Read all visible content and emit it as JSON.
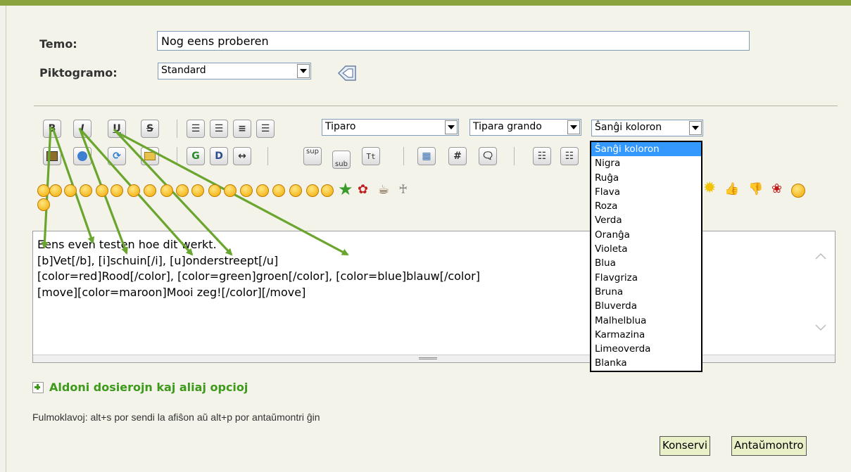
{
  "subject": {
    "label": "Temo:",
    "value": "Nog eens proberen"
  },
  "icon": {
    "label": "Piktogramo:",
    "value": "Standard"
  },
  "toolbar": {
    "row1": [
      "B",
      "I",
      "U",
      "S"
    ],
    "font_face": "Tiparo",
    "font_size": "Tipara grando",
    "font_color": "Ŝanĝi koloron",
    "row2_labels": {
      "g": "G",
      "sup": "sup",
      "sub": "sub",
      "tt": "Tt",
      "hash": "#"
    }
  },
  "color_options": [
    "Ŝanĝi koloron",
    "Nigra",
    "Ruĝa",
    "Flava",
    "Roza",
    "Verda",
    "Oranĝa",
    "Violeta",
    "Blua",
    "Flavgriza",
    "Bruna",
    "Bluverda",
    "Malhelblua",
    "Karmazina",
    "Limeoverda",
    "Blanka"
  ],
  "editor": {
    "lines": [
      "Eens even testen hoe dit werkt.",
      "[b]Vet[/b], [i]schuin[/i], [u]onderstreept[/u]",
      "[color=red]Rood[/color], [color=green]groen[/color], [color=blue]blauw[/color]",
      "[move][color=maroon]Mooi zeg![/color][/move]"
    ]
  },
  "more_options": "Aldoni dosierojn kaj aliaj opcioj",
  "shortcuts": "Fulmoklavoj: alt+s por sendi la afiŝon aŭ alt+p por antaŭmontri ĝin",
  "buttons": {
    "save": "Konservi",
    "preview": "Antaŭmontro"
  },
  "colors": {
    "accent_green": "#3d9a1a",
    "arrow_green": "#6aa52e",
    "selected_blue": "#3399ff",
    "button_bg": "#e9f0c8"
  }
}
